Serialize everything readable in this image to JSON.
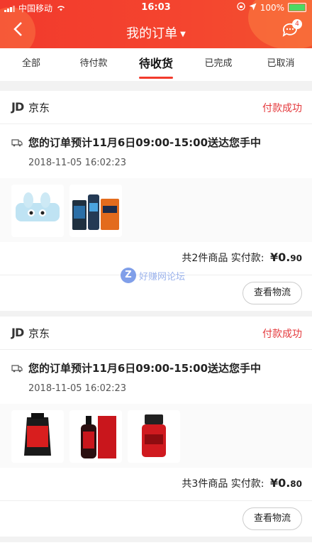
{
  "status_bar": {
    "carrier": "中国移动",
    "time": "16:03",
    "battery": "100%"
  },
  "nav": {
    "title": "我的订单",
    "badge": "4"
  },
  "tabs": [
    "全部",
    "待付款",
    "待收货",
    "已完成",
    "已取消"
  ],
  "orders": [
    {
      "logo": "JD",
      "shop": "京东",
      "status": "付款成功",
      "delivery": "您的订单预计11月6日09:00-15:00送达您手中",
      "time": "2018-11-05 16:02:23",
      "summary_count": "共2件商品",
      "summary_label": "实付款:",
      "price_main": "¥0.",
      "price_small": "90",
      "button": "查看物流"
    },
    {
      "logo": "JD",
      "shop": "京东",
      "status": "付款成功",
      "delivery": "您的订单预计11月6日09:00-15:00送达您手中",
      "time": "2018-11-05 16:02:23",
      "summary_count": "共3件商品",
      "summary_label": "实付款:",
      "price_main": "¥0.",
      "price_small": "80",
      "button": "查看物流"
    }
  ],
  "watermark": {
    "letter": "Z",
    "text": "好赚网论坛"
  }
}
